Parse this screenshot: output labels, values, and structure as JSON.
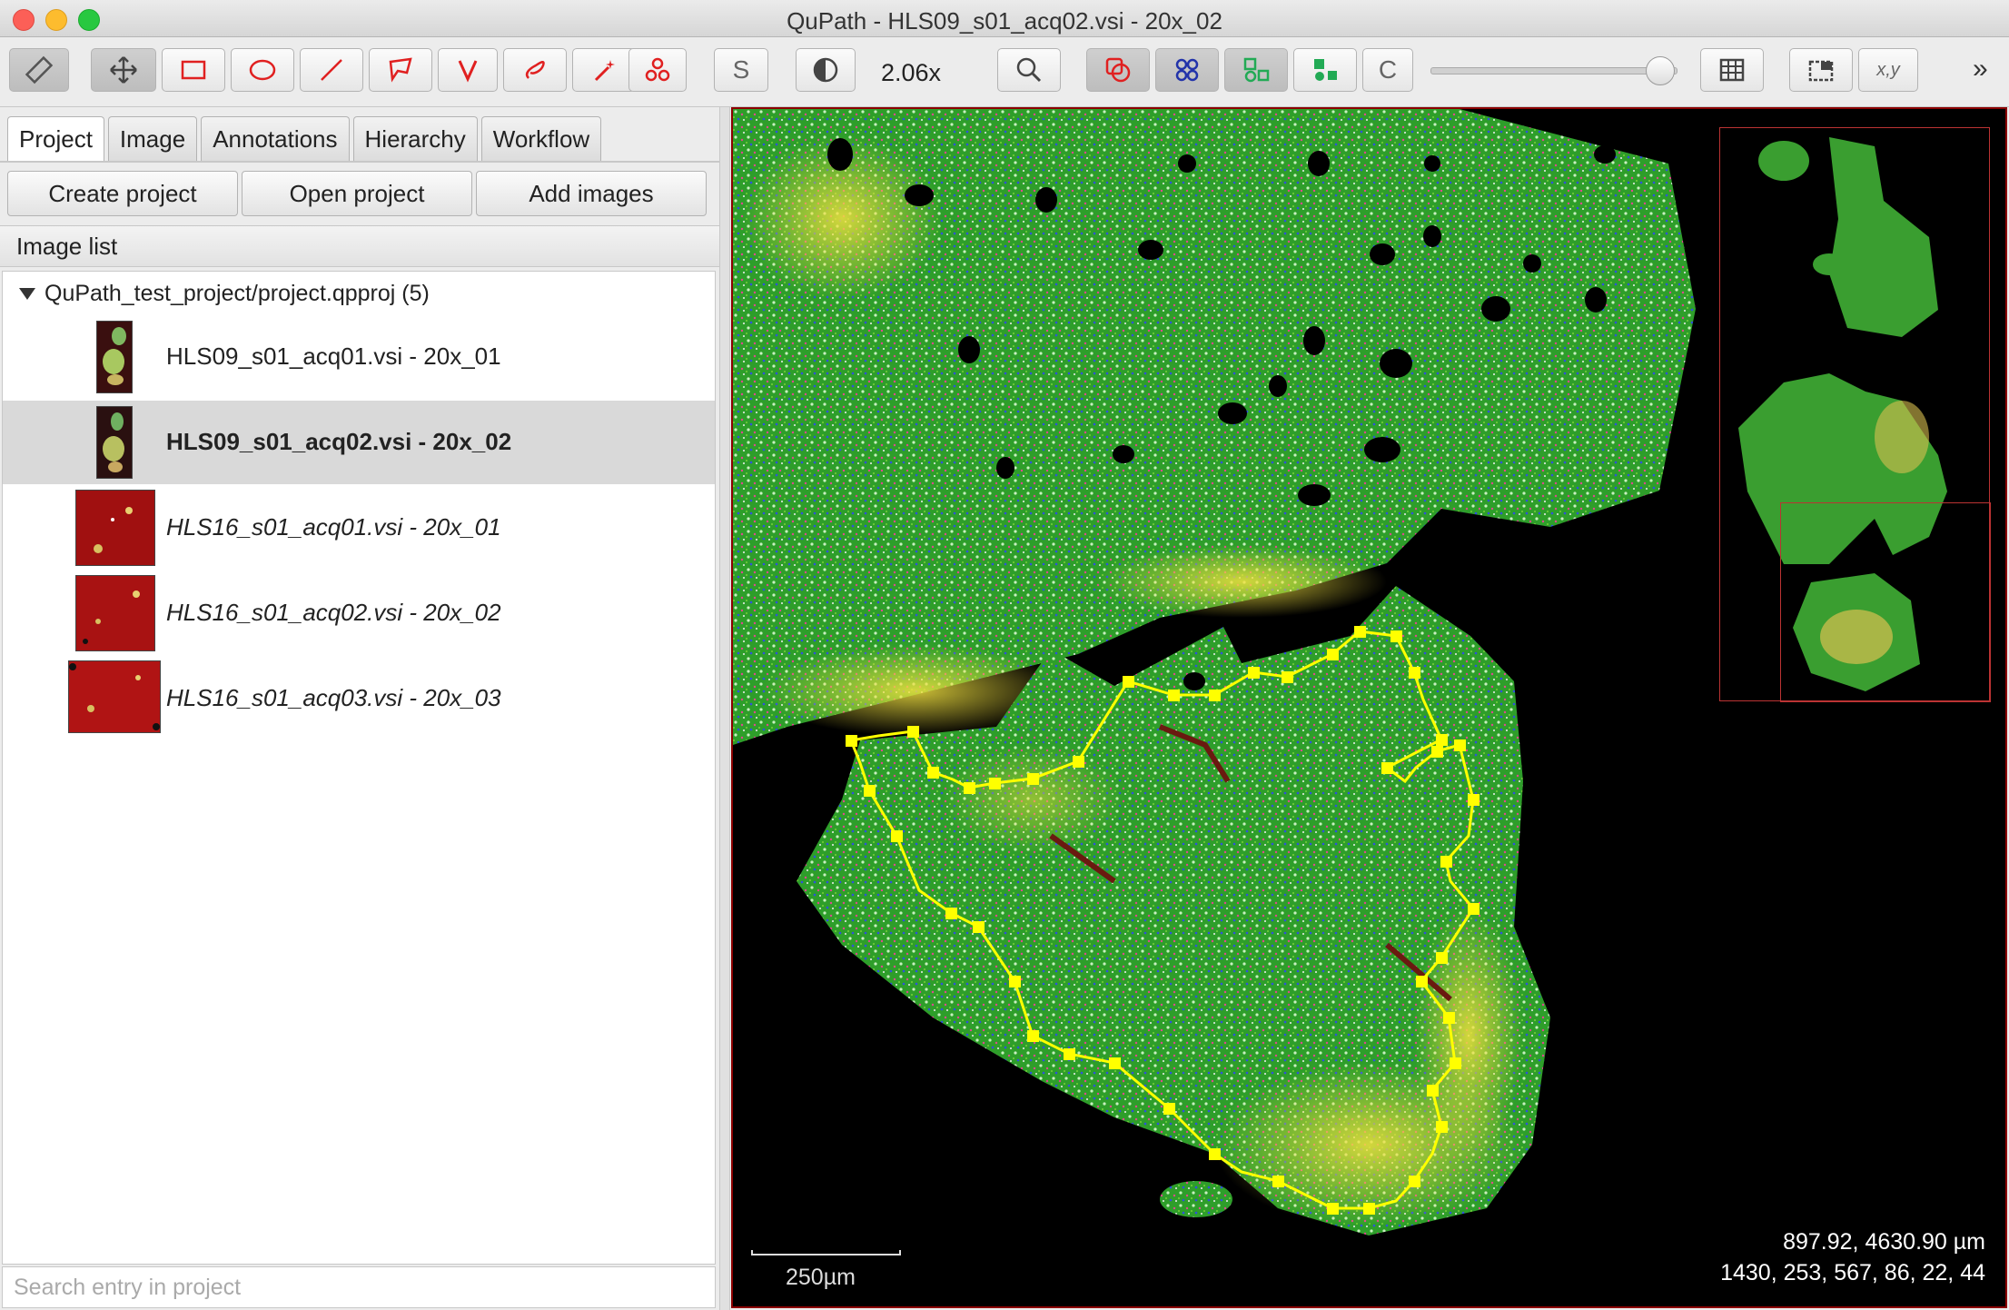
{
  "window": {
    "title": "QuPath - HLS09_s01_acq02.vsi - 20x_02"
  },
  "toolbar": {
    "zoom_value": "2.06x",
    "s_label": "S",
    "c_label": "C",
    "xy_label": "x,y",
    "more_label": "»",
    "icons": [
      "ruler-icon",
      "move-icon",
      "rectangle-icon",
      "ellipse-icon",
      "line-icon",
      "polygon-icon",
      "polyline-icon",
      "brush-icon",
      "wand-icon",
      "points-icon",
      "selection-mode-s",
      "contrast-icon",
      "zoom-to-fit-icon",
      "show-annotations-icon",
      "show-detections-icon",
      "fill-annotations-icon",
      "fill-detections-icon",
      "cell-boundaries-icon",
      "opacity-slider",
      "grid-icon",
      "overview-icon",
      "coordinates-icon"
    ]
  },
  "tabs": [
    {
      "label": "Project",
      "selected": true
    },
    {
      "label": "Image",
      "selected": false
    },
    {
      "label": "Annotations",
      "selected": false
    },
    {
      "label": "Hierarchy",
      "selected": false
    },
    {
      "label": "Workflow",
      "selected": false
    }
  ],
  "project_buttons": {
    "create": "Create project",
    "open": "Open project",
    "add": "Add images"
  },
  "image_list": {
    "header": "Image list",
    "root": "QuPath_test_project/project.qpproj (5)",
    "items": [
      {
        "name": "HLS09_s01_acq01.vsi - 20x_01",
        "style": "normal",
        "selected": false
      },
      {
        "name": "HLS09_s01_acq02.vsi - 20x_02",
        "style": "bold",
        "selected": true
      },
      {
        "name": "HLS16_s01_acq01.vsi - 20x_01",
        "style": "italic",
        "selected": false
      },
      {
        "name": "HLS16_s01_acq02.vsi - 20x_02",
        "style": "italic",
        "selected": false
      },
      {
        "name": "HLS16_s01_acq03.vsi - 20x_03",
        "style": "italic",
        "selected": false
      }
    ]
  },
  "search": {
    "placeholder": "Search entry in project"
  },
  "viewer": {
    "scalebar_label": "250µm",
    "cursor_position": "897.92, 4630.90 µm",
    "pixel_values": "1430, 253, 567, 86, 22, 44",
    "annotation_color": "#ffff00",
    "border_color": "#8b0000"
  },
  "colors": {
    "tool_red": "#e02020",
    "tool_blue": "#2233aa",
    "tool_green": "#22aa55"
  }
}
